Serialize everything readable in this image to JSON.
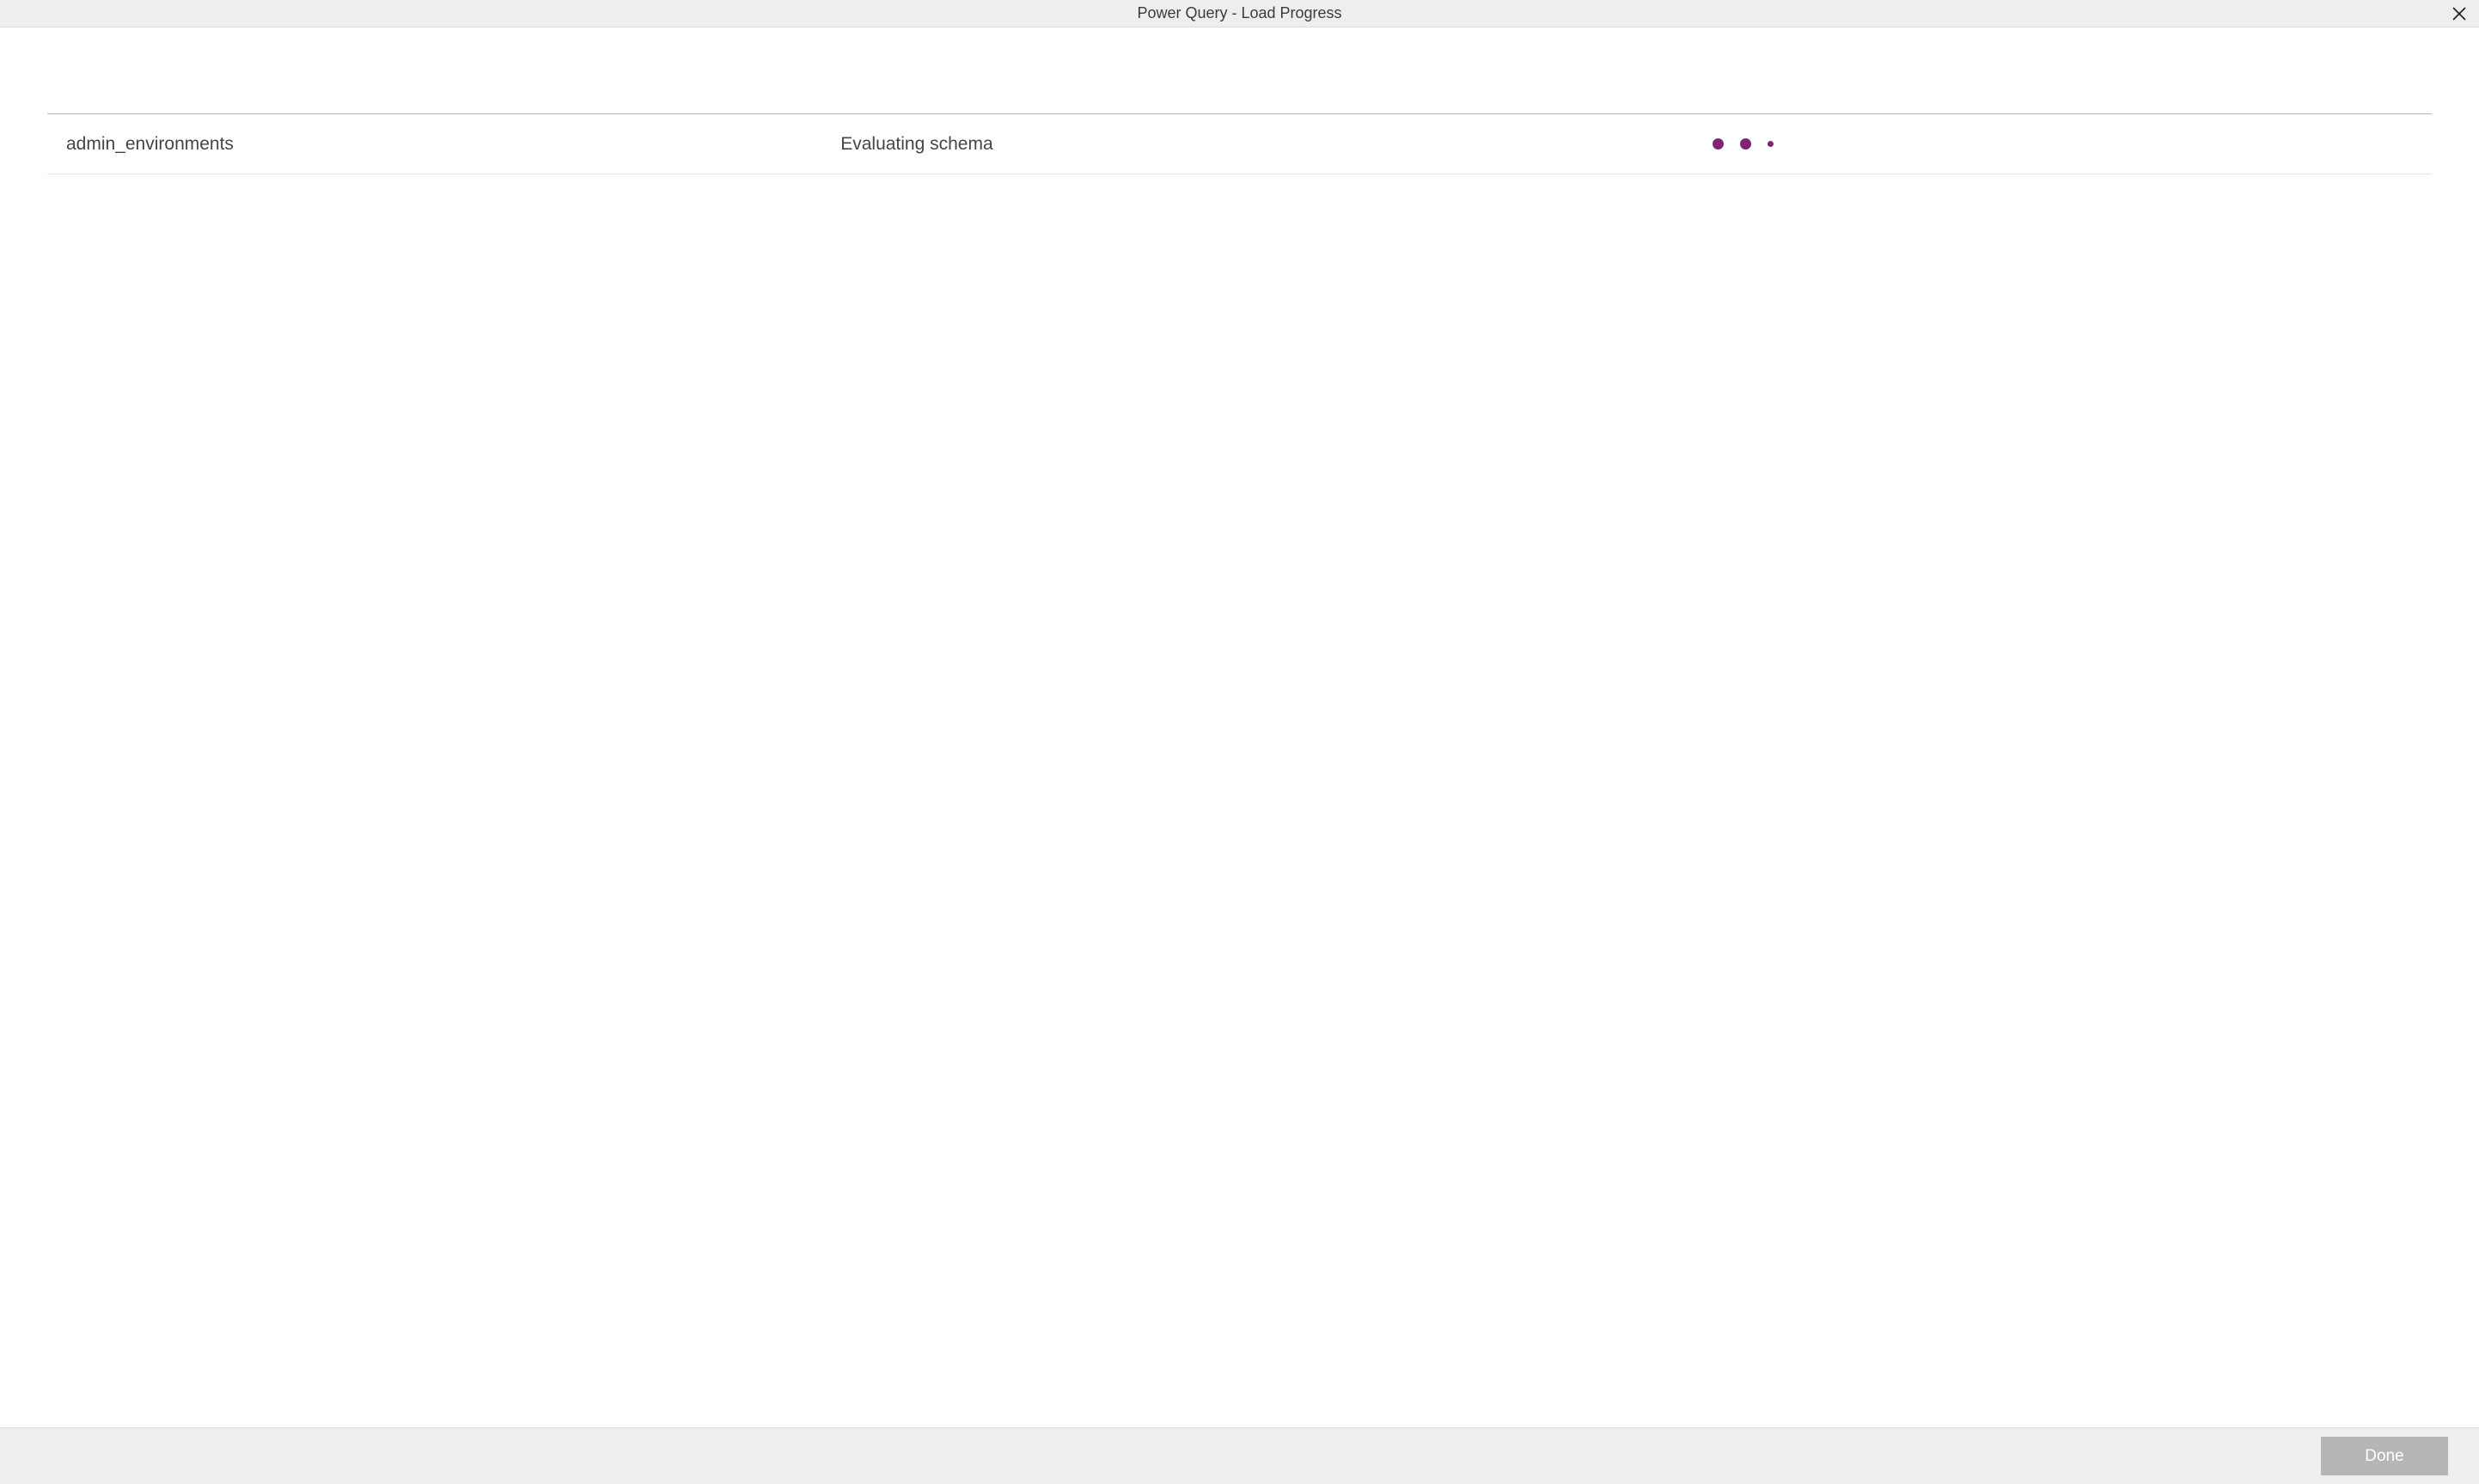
{
  "titlebar": {
    "title": "Power Query - Load Progress"
  },
  "progress": {
    "rows": [
      {
        "name": "admin_environments",
        "status": "Evaluating schema"
      }
    ]
  },
  "footer": {
    "done_label": "Done"
  },
  "colors": {
    "accent": "#7f2472",
    "titlebar_bg": "#eeeeee",
    "footer_bg": "#eeeeee",
    "done_disabled_bg": "#b6b6b6"
  }
}
